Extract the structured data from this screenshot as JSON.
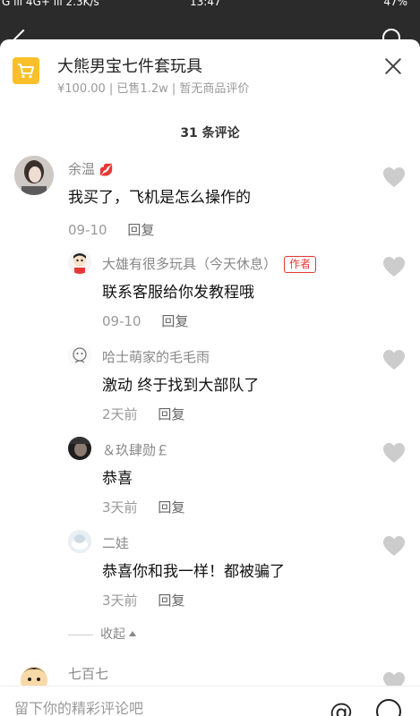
{
  "status_bar": {
    "left": "G ıll 4G+ ıll 2.3K/s",
    "time": "13:47",
    "right": "47%"
  },
  "product": {
    "title": "大熊男宝七件套玩具",
    "price": "¥100.00",
    "sold": "已售1.2w",
    "rating": "暂无商品评价"
  },
  "comment_count": "31 条评论",
  "comments": [
    {
      "name": "余温",
      "name_emoji": "💋",
      "text": "我买了，飞机是怎么操作的",
      "time": "09-10",
      "reply": "回复"
    },
    {
      "name": "大雄有很多玩具（今天休息）",
      "tag": "作者",
      "text": "联系客服给你发教程哦",
      "time": "09-10",
      "reply": "回复"
    },
    {
      "name": "哈士萌家的毛毛雨",
      "text": "激动 终于找到大部队了",
      "time": "2天前",
      "reply": "回复"
    },
    {
      "name": "＆玖肆勋￡",
      "text": "恭喜",
      "time": "3天前",
      "reply": "回复"
    },
    {
      "name": "二娃",
      "text": "恭喜你和我一样！都被骗了",
      "time": "3天前",
      "reply": "回复"
    },
    {
      "name": "七百七"
    }
  ],
  "collapse_label": "收起",
  "input": {
    "placeholder": "留下你的精彩评论吧"
  },
  "colors": {
    "cart": "#f9c02a",
    "author_tag": "#e53935",
    "heart": "#cccccc"
  }
}
